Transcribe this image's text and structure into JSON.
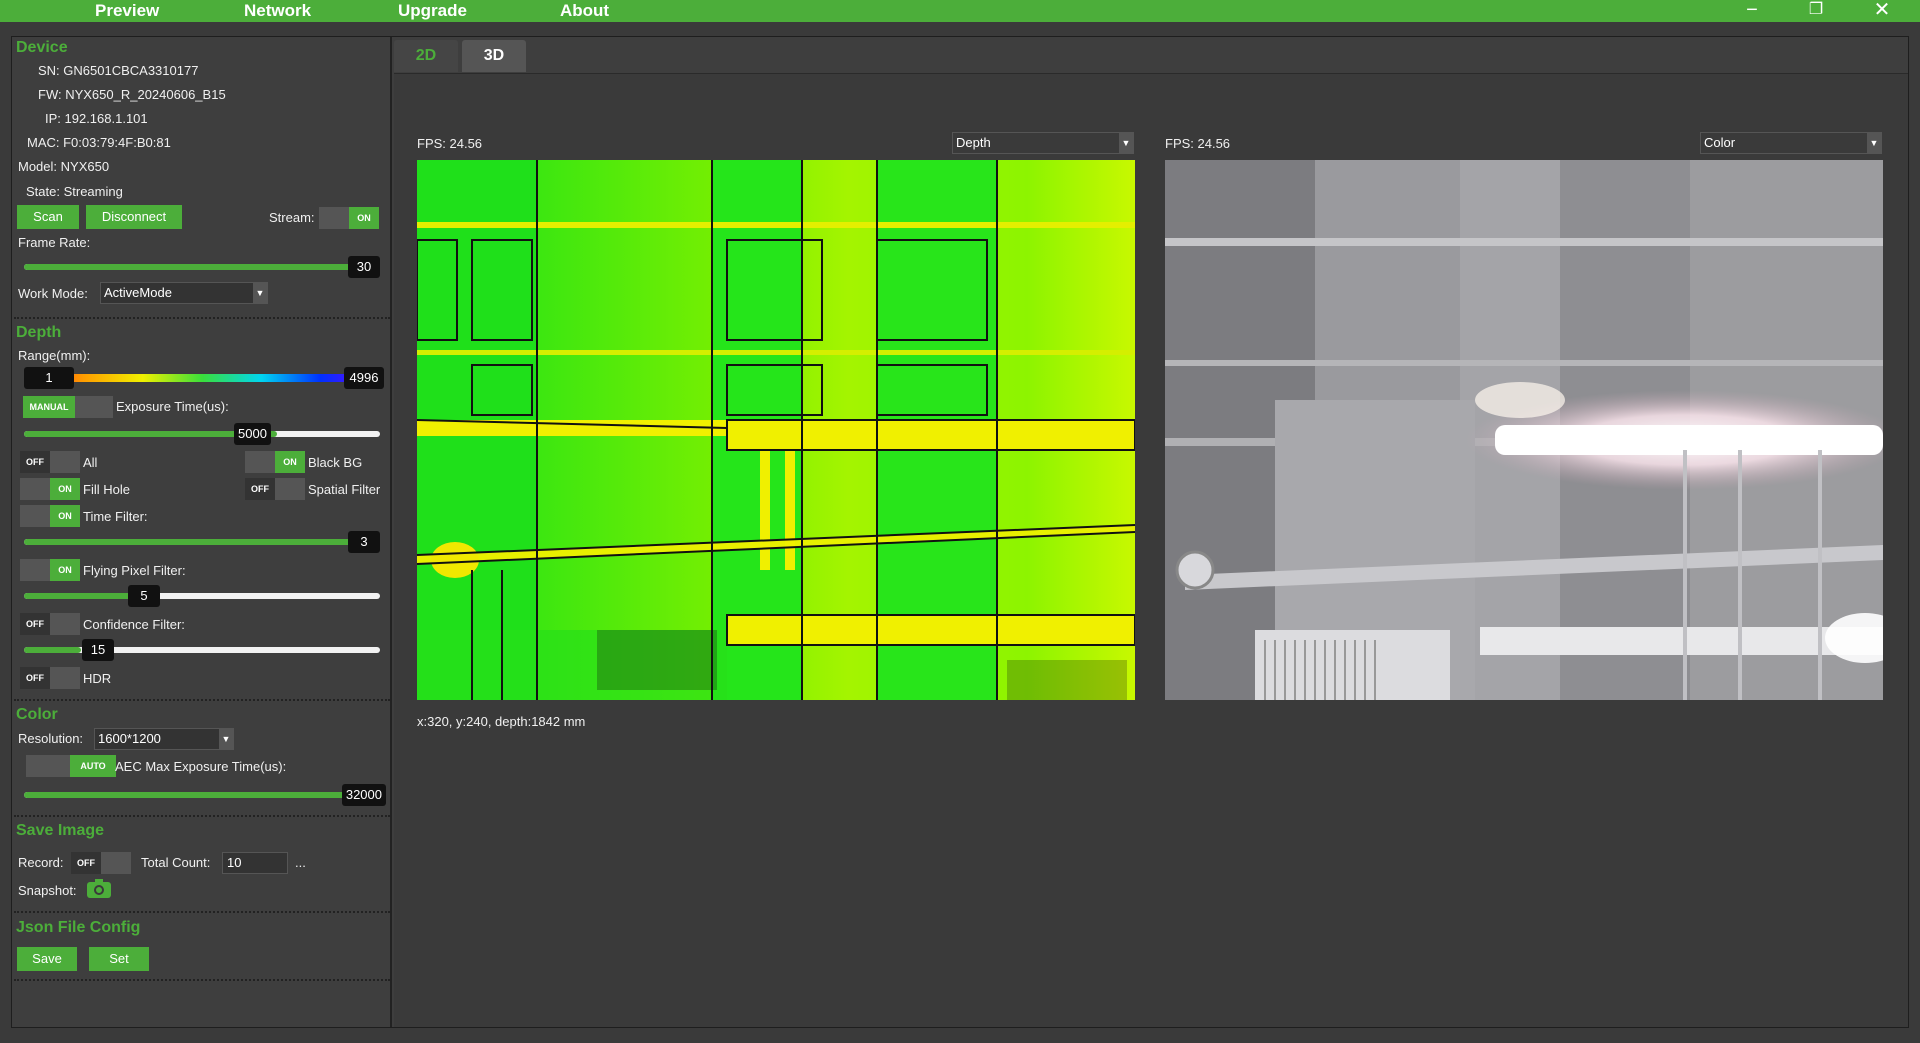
{
  "menu": {
    "preview": "Preview",
    "network": "Network",
    "upgrade": "Upgrade",
    "about": "About"
  },
  "window_controls": {
    "minimize": "−",
    "restore": "❐",
    "close": "✕"
  },
  "device": {
    "title": "Device",
    "sn": "SN: GN6501CBCA3310177",
    "fw": "FW: NYX650_R_20240606_B15",
    "ip": "IP: 192.168.1.101",
    "mac": "MAC: F0:03:79:4F:B0:81",
    "model": "Model: NYX650",
    "state": "State: Streaming",
    "scan_label": "Scan",
    "disconnect_label": "Disconnect",
    "stream_label": "Stream:",
    "stream_toggle": "ON",
    "frame_rate_label": "Frame Rate:",
    "frame_rate_value": "30",
    "frame_rate_fraction": 0.97,
    "work_mode_label": "Work Mode:",
    "work_mode_value": "ActiveMode"
  },
  "depth": {
    "title": "Depth",
    "range_label": "Range(mm):",
    "range_min": "1",
    "range_max": "4996",
    "exposure_mode": "MANUAL",
    "exposure_label": "Exposure Time(us):",
    "exposure_value": "5000",
    "exposure_fraction": 0.71,
    "all_toggle": "OFF",
    "all_label": "All",
    "black_bg_toggle": "ON",
    "black_bg_label": "Black BG",
    "fill_hole_toggle": "ON",
    "fill_hole_label": "Fill Hole",
    "spatial_filter_toggle": "OFF",
    "spatial_filter_label": "Spatial Filter",
    "time_filter_toggle": "ON",
    "time_filter_label": "Time Filter:",
    "time_filter_value": "3",
    "time_filter_fraction": 0.97,
    "flying_pixel_toggle": "ON",
    "flying_pixel_label": "Flying Pixel Filter:",
    "flying_pixel_value": "5",
    "flying_pixel_fraction": 0.31,
    "confidence_toggle": "OFF",
    "confidence_label": "Confidence Filter:",
    "confidence_value": "15",
    "confidence_fraction": 0.16,
    "hdr_toggle": "OFF",
    "hdr_label": "HDR"
  },
  "color": {
    "title": "Color",
    "resolution_label": "Resolution:",
    "resolution_value": "1600*1200",
    "aec_toggle": "AUTO",
    "aec_label": "AEC Max Exposure Time(us):",
    "aec_value": "32000",
    "aec_fraction": 0.97
  },
  "save_image": {
    "title": "Save Image",
    "record_label": "Record:",
    "record_toggle": "OFF",
    "total_count_label": "Total Count:",
    "total_count_value": "10",
    "ellipsis": "...",
    "snapshot_label": "Snapshot:"
  },
  "json_config": {
    "title": "Json File Config",
    "save_label": "Save",
    "set_label": "Set"
  },
  "tabs": {
    "tab_2d": "2D",
    "tab_3d": "3D"
  },
  "depth_view": {
    "fps": "FPS: 24.56",
    "mode": "Depth",
    "readout": "x:320, y:240, depth:1842 mm"
  },
  "color_view": {
    "fps": "FPS: 24.56",
    "mode": "Color"
  },
  "colors": {
    "accent": "#4cae3a",
    "depth_green": "#1ee81e",
    "depth_yellow": "#f0f000"
  }
}
